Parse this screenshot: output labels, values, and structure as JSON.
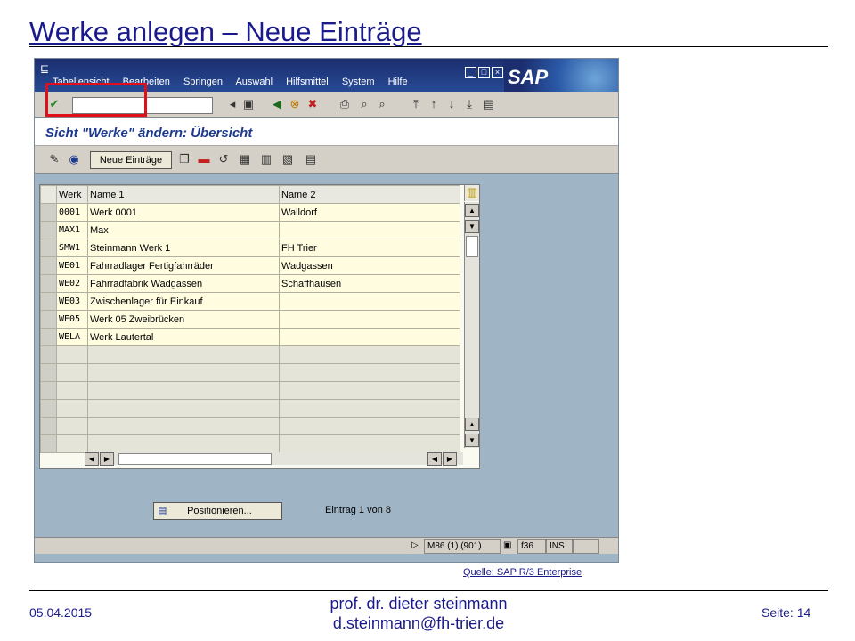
{
  "slide": {
    "title": "Werke anlegen – Neue Einträge",
    "source": "Quelle: SAP R/3 Enterprise",
    "date": "05.04.2015",
    "author_line1": "prof. dr. dieter steinmann",
    "author_line2": "d.steinmann@fh-trier.de",
    "page": "Seite: 14"
  },
  "sap": {
    "logo": "SAP",
    "menu": [
      "Tabellensicht",
      "Bearbeiten",
      "Springen",
      "Auswahl",
      "Hilfsmittel",
      "System",
      "Hilfe"
    ],
    "screen_title": "Sicht \"Werke\" ändern: Übersicht",
    "neue_eintraege_label": "Neue Einträge",
    "columns": [
      "Werk",
      "Name 1",
      "Name 2"
    ],
    "rows": [
      {
        "werk": "0001",
        "name1": "Werk 0001",
        "name2": "Walldorf"
      },
      {
        "werk": "MAX1",
        "name1": "Max",
        "name2": ""
      },
      {
        "werk": "SMW1",
        "name1": "Steinmann Werk 1",
        "name2": "FH Trier"
      },
      {
        "werk": "WE01",
        "name1": "Fahrradlager Fertigfahrräder",
        "name2": "Wadgassen"
      },
      {
        "werk": "WE02",
        "name1": "Fahrradfabrik Wadgassen",
        "name2": "Schaffhausen"
      },
      {
        "werk": "WE03",
        "name1": "Zwischenlager für Einkauf",
        "name2": ""
      },
      {
        "werk": "WE05",
        "name1": "Werk 05 Zweibrücken",
        "name2": ""
      },
      {
        "werk": "WELA",
        "name1": "Werk Lautertal",
        "name2": ""
      }
    ],
    "positionieren_label": "Positionieren...",
    "entry_count": "Eintrag 1 von 8",
    "status": {
      "session": "M86 (1) (901)",
      "key": "f36",
      "mode": "INS"
    }
  }
}
